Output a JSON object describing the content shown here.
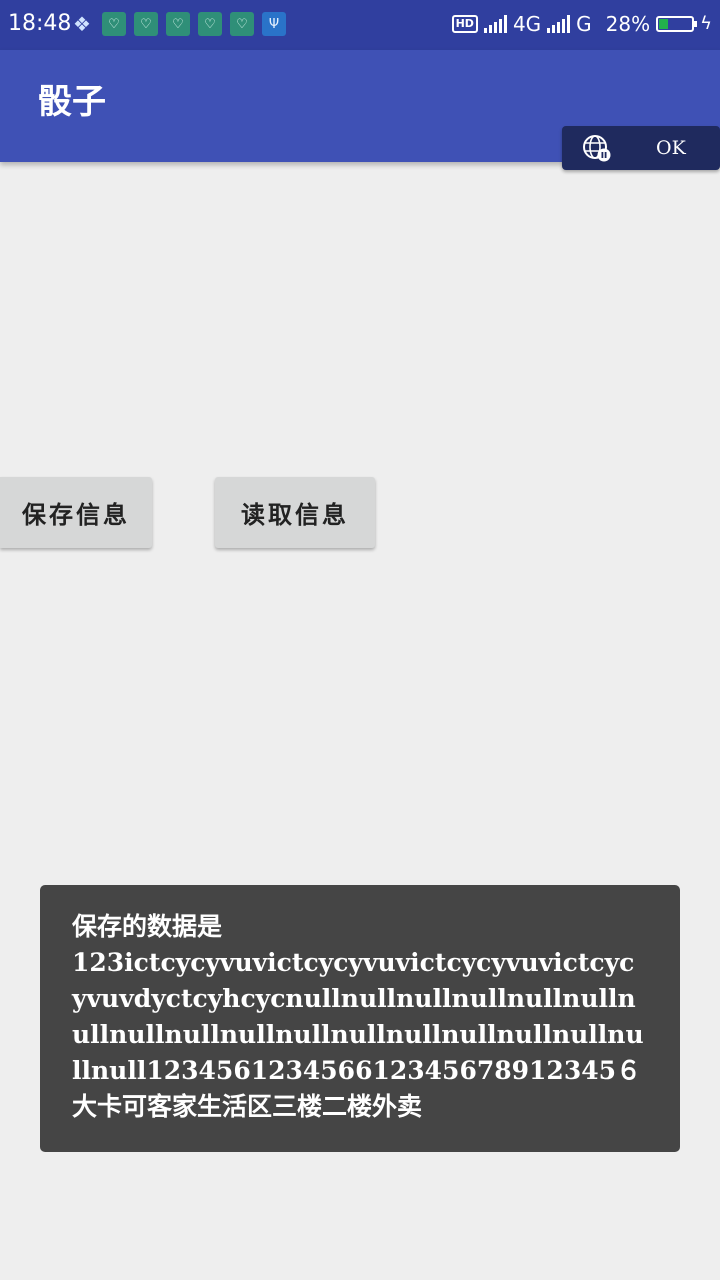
{
  "status_bar": {
    "time": "18:48",
    "left_icons": [
      "cube-app-icon",
      "heart-app-icon",
      "heart-app-icon",
      "heart-app-icon",
      "heart-app-icon",
      "heart-app-icon",
      "usb-icon"
    ],
    "hd_badge": "HD",
    "network_primary": "4G",
    "network_secondary": "G",
    "battery_percent": "28%",
    "battery_level": 0.28,
    "charging": true
  },
  "app_bar": {
    "title": "骰子"
  },
  "vpn_chip": {
    "icon": "globe-pause-icon",
    "label": "OK"
  },
  "buttons": {
    "save_label": "保存信息",
    "read_label": "读取信息"
  },
  "toast": {
    "message": "保存的数据是\n123ictcycyvuvictcycyvuvictcycyvuvictcycyvuvdyctcyhcycnullnullnullnullnullnullnullnullnullnullnullnullnullnullnullnullnullnull123456123456612345678912345６大卡可客家生活区三楼二楼外卖"
  },
  "colors": {
    "status_bar": "#303f9f",
    "app_bar": "#3f51b5",
    "background": "#eeeeee",
    "button": "#d6d7d7",
    "toast": "#454545"
  }
}
